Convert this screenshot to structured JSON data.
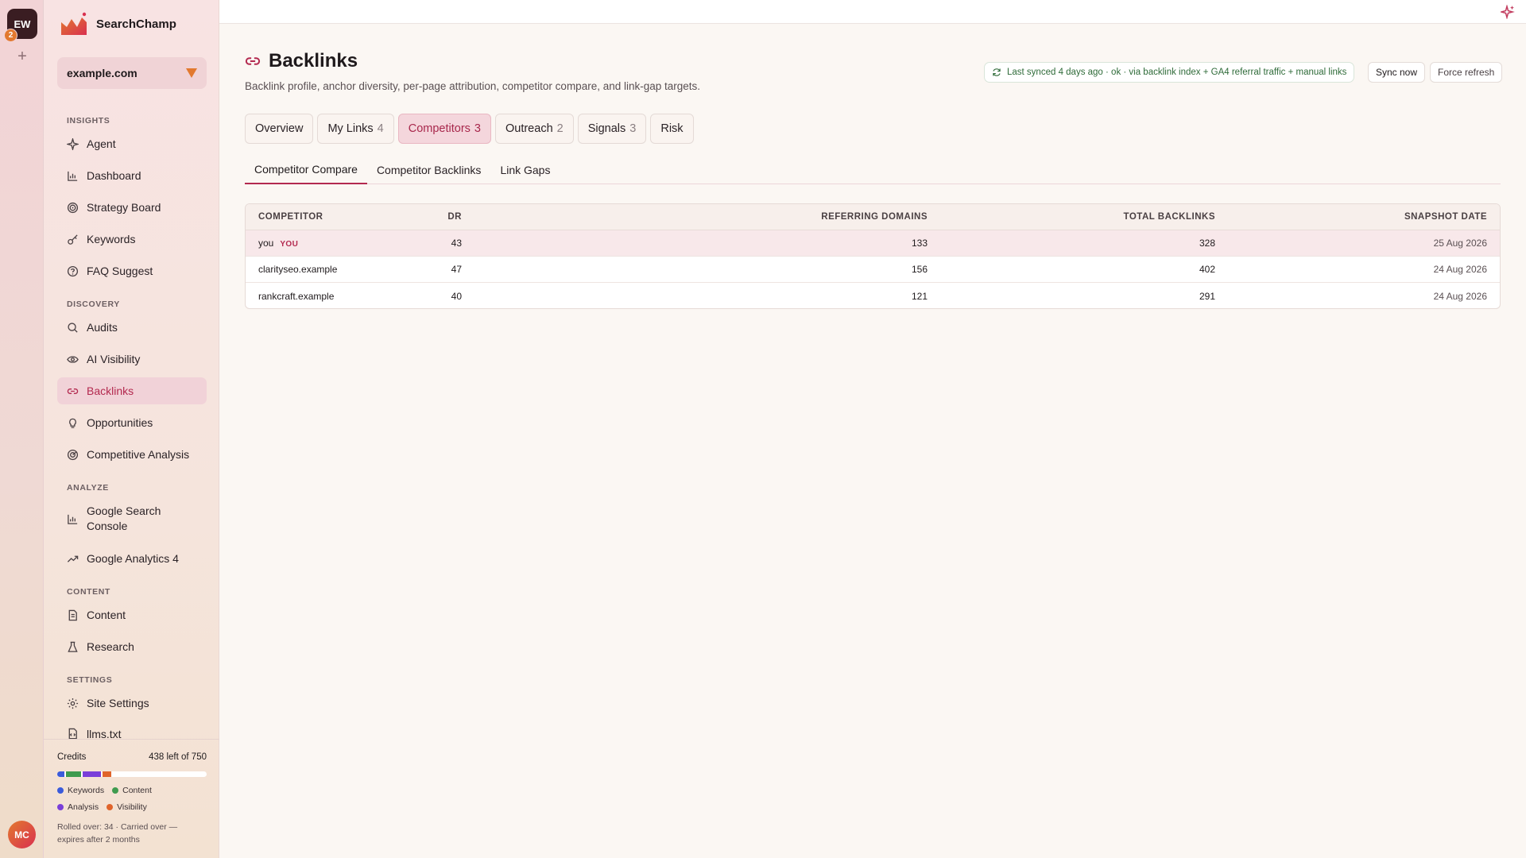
{
  "rail": {
    "workspace": "EW",
    "workspace_count": "2",
    "add": "+",
    "user": "MC"
  },
  "brand": {
    "name": "SearchChamp"
  },
  "site": {
    "name": "example.com"
  },
  "nav": {
    "insights": "INSIGHTS",
    "discovery": "DISCOVERY",
    "analyze": "ANALYZE",
    "content": "CONTENT",
    "settings": "SETTINGS",
    "items": {
      "agent": "Agent",
      "dashboard": "Dashboard",
      "strategy": "Strategy Board",
      "keywords": "Keywords",
      "faq": "FAQ Suggest",
      "audits": "Audits",
      "ai_visibility": "AI Visibility",
      "backlinks": "Backlinks",
      "opportunities": "Opportunities",
      "competitive": "Competitive Analysis",
      "gsc": "Google Search Console",
      "ga4": "Google Analytics 4",
      "content": "Content",
      "research": "Research",
      "site_settings": "Site Settings",
      "llms": "llms.txt"
    }
  },
  "credits": {
    "label": "Credits",
    "remaining": "438 left of 750",
    "segments": [
      {
        "name": "Keywords",
        "color": "#3b5bdb",
        "fraction": 0.05
      },
      {
        "name": "Content",
        "color": "#3f9b4f",
        "fraction": 0.1
      },
      {
        "name": "Analysis",
        "color": "#7a3fd9",
        "fraction": 0.12
      },
      {
        "name": "Visibility",
        "color": "#e0642b",
        "fraction": 0.06
      }
    ],
    "legend": {
      "keywords": "Keywords",
      "content": "Content",
      "analysis": "Analysis",
      "visibility": "Visibility"
    },
    "rolled": "Rolled over: 34 · Carried over — expires after 2 months"
  },
  "page": {
    "title": "Backlinks",
    "subtitle": "Backlink profile, anchor diversity, per-page attribution, competitor compare, and link-gap targets.",
    "sync_status": "Last synced 4 days ago · ok · via backlink index + GA4 referral traffic + manual links",
    "sync_now": "Sync now",
    "force_refresh": "Force refresh"
  },
  "tabs": [
    {
      "label": "Overview",
      "count": ""
    },
    {
      "label": "My Links",
      "count": "4"
    },
    {
      "label": "Competitors",
      "count": "3"
    },
    {
      "label": "Outreach",
      "count": "2"
    },
    {
      "label": "Signals",
      "count": "3"
    },
    {
      "label": "Risk",
      "count": ""
    }
  ],
  "subtabs": [
    "Competitor Compare",
    "Competitor Backlinks",
    "Link Gaps"
  ],
  "table": {
    "headers": [
      "COMPETITOR",
      "DR",
      "REFERRING DOMAINS",
      "TOTAL BACKLINKS",
      "SNAPSHOT DATE"
    ],
    "you_tag": "YOU",
    "rows": [
      {
        "competitor": "you",
        "dr": "43",
        "ref_domains": "133",
        "backlinks": "328",
        "date": "25 Aug 2026"
      },
      {
        "competitor": "clarityseo.example",
        "dr": "47",
        "ref_domains": "156",
        "backlinks": "402",
        "date": "24 Aug 2026"
      },
      {
        "competitor": "rankcraft.example",
        "dr": "40",
        "ref_domains": "121",
        "backlinks": "291",
        "date": "24 Aug 2026"
      }
    ]
  },
  "colors": {
    "accent": "#b3294f",
    "brand_orange": "#e2792f",
    "sync_green": "#2f6b39"
  }
}
